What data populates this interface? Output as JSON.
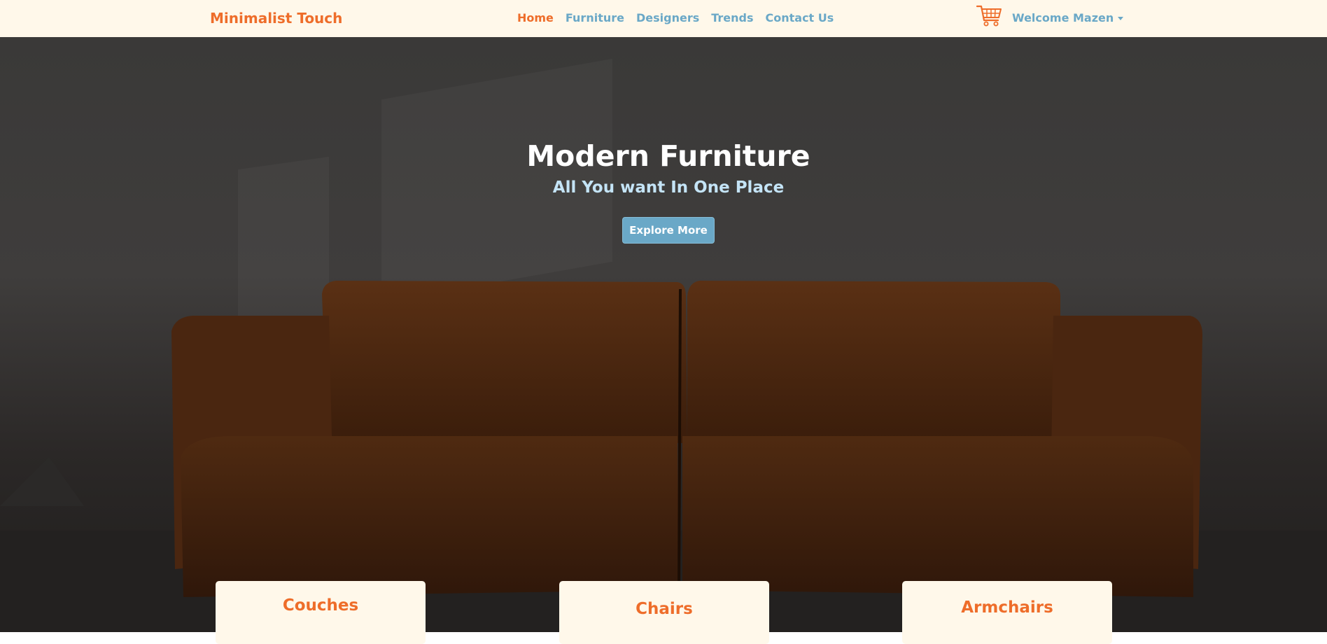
{
  "nav": {
    "brand": "Minimalist Touch",
    "links": [
      "Home",
      "Furniture",
      "Designers",
      "Trends",
      "Contact Us"
    ],
    "user": "Welcome Mazen"
  },
  "hero": {
    "title": "Modern Furniture",
    "subtitle": "All You want In One Place",
    "button": "Explore More"
  },
  "categories": [
    "Couches",
    "Chairs",
    "Armchairs"
  ],
  "colors": {
    "accent": "#ee6d2a",
    "link": "#6aa8c7",
    "navbar_bg": "#fff8ea",
    "button_bg": "#6aa8c7"
  },
  "icons": {
    "cart": "shopping-cart-icon",
    "caret": "chevron-down-icon"
  }
}
